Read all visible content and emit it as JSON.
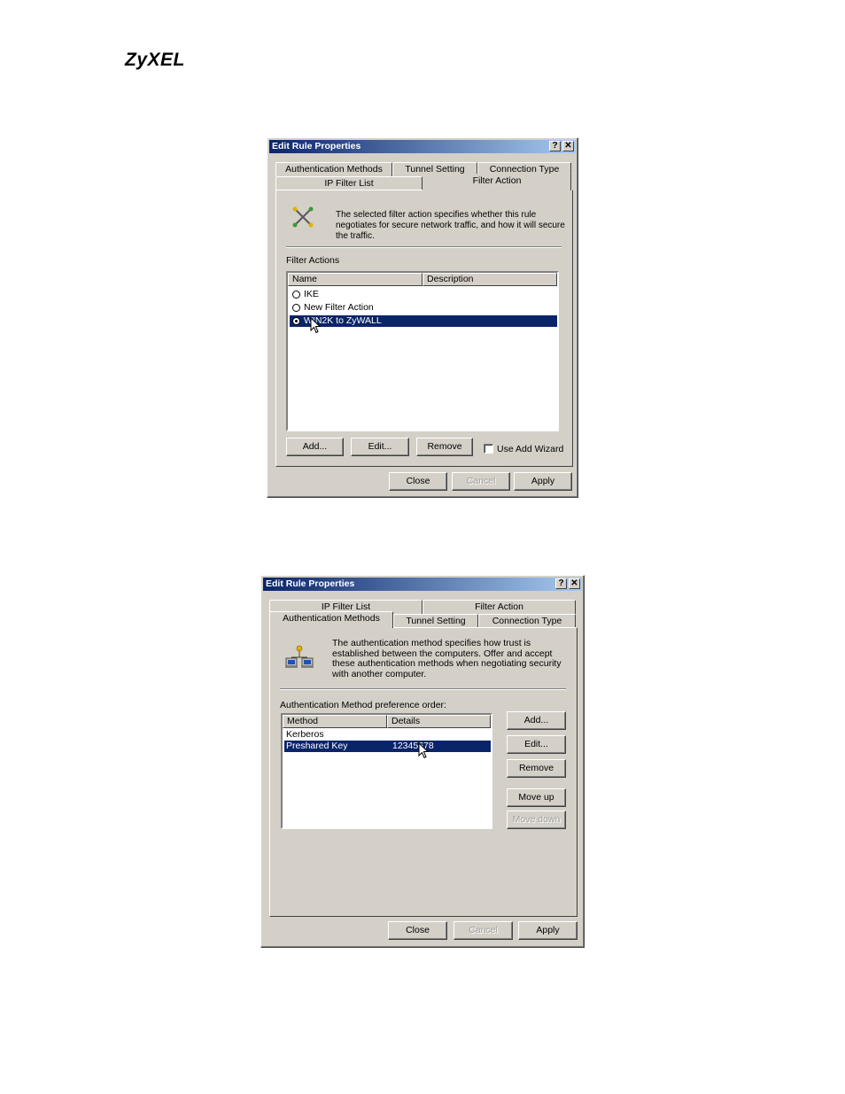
{
  "brand": "ZyXEL",
  "dialog1": {
    "title": "Edit Rule Properties",
    "help_btn": "?",
    "close_btn": "✕",
    "tabs_back": [
      "Authentication Methods",
      "Tunnel Setting",
      "Connection Type"
    ],
    "tabs_front": [
      "IP Filter List",
      "Filter Action"
    ],
    "active_tab": "Filter Action",
    "description": "The selected filter action specifies whether this rule negotiates for secure network traffic, and how it will secure the traffic.",
    "section_label": "Filter Actions",
    "columns": [
      "Name",
      "Description"
    ],
    "rows": [
      {
        "name": "IKE",
        "selected": false
      },
      {
        "name": "New Filter Action",
        "selected": false
      },
      {
        "name": "WIN2K to ZyWALL",
        "selected": true
      }
    ],
    "buttons": {
      "add": "Add...",
      "edit": "Edit...",
      "remove": "Remove"
    },
    "checkbox_label": "Use Add Wizard",
    "checkbox_checked": false,
    "footer": {
      "close": "Close",
      "cancel": "Cancel",
      "apply": "Apply"
    }
  },
  "dialog2": {
    "title": "Edit Rule Properties",
    "help_btn": "?",
    "close_btn": "✕",
    "tabs_back": [
      "IP Filter List",
      "Filter Action"
    ],
    "tabs_front": [
      "Authentication Methods",
      "Tunnel Setting",
      "Connection Type"
    ],
    "active_tab": "Authentication Methods",
    "description": "The authentication method specifies how trust is established between the computers. Offer and accept these authentication methods when negotiating security with another computer.",
    "section_label": "Authentication Method preference order:",
    "columns": [
      "Method",
      "Details"
    ],
    "rows": [
      {
        "method": "Kerberos",
        "details": "",
        "selected": false
      },
      {
        "method": "Preshared Key",
        "details": "12345678",
        "selected": true
      }
    ],
    "buttons": {
      "add": "Add...",
      "edit": "Edit...",
      "remove": "Remove",
      "move_up": "Move up",
      "move_down": "Move down"
    },
    "footer": {
      "close": "Close",
      "cancel": "Cancel",
      "apply": "Apply"
    }
  }
}
